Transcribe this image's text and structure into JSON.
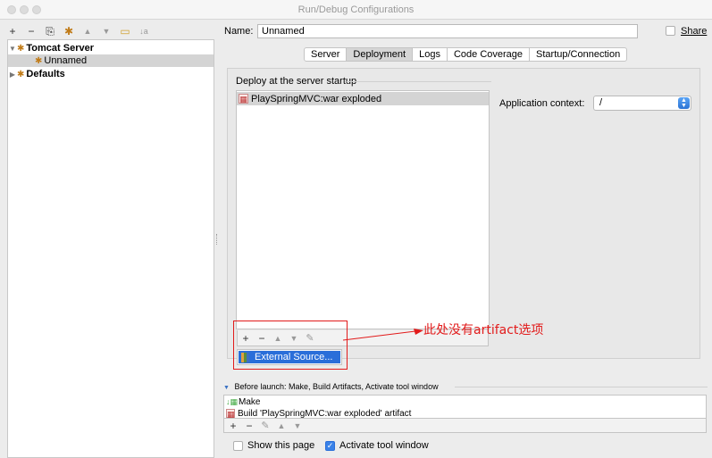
{
  "window": {
    "title": "Run/Debug Configurations"
  },
  "left_toolbar": {
    "add": "+",
    "remove": "−",
    "copy": "⎘",
    "settings": "✱",
    "up": "▲",
    "down": "▼",
    "folder": "▭",
    "sort": "↓a"
  },
  "tree": {
    "tomcat_label": "Tomcat Server",
    "unnamed_label": "Unnamed",
    "defaults_label": "Defaults"
  },
  "config": {
    "name_label": "Name:",
    "name_value": "Unnamed",
    "share_label": "Share"
  },
  "tabs": [
    {
      "label": "Server"
    },
    {
      "label": "Deployment"
    },
    {
      "label": "Logs"
    },
    {
      "label": "Code Coverage"
    },
    {
      "label": "Startup/Connection"
    }
  ],
  "deployment": {
    "group_title": "Deploy at the server startup",
    "artifacts": [
      "PlaySpringMVC:war exploded"
    ],
    "context_label": "Application context:",
    "context_value": "/",
    "popup_item": "External Source..."
  },
  "annotation": {
    "text": "此处没有artifact选项",
    "color": "#e21b1b"
  },
  "before_launch": {
    "title": "Before launch: Make, Build Artifacts, Activate tool window",
    "items": [
      "Make",
      "Build 'PlaySpringMVC:war exploded' artifact"
    ]
  },
  "options": {
    "show_page_label": "Show this page",
    "activate_tool_label": "Activate tool window"
  },
  "colors": {
    "accent": "#2a6ed9",
    "selection": "#d4d4d4"
  }
}
